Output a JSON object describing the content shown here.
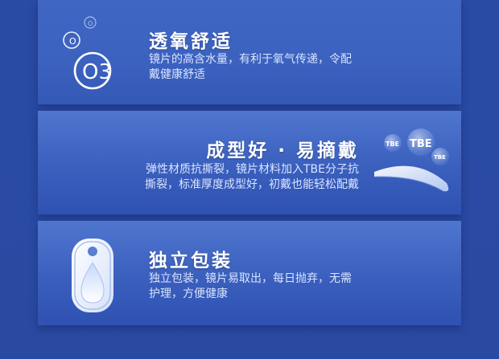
{
  "features": [
    {
      "title": "透氧舒适",
      "desc_lines": [
        "镜片的高含水量，有利于氧气传递，令配",
        "戴健康舒适"
      ],
      "icon": "o3-bubbles-icon",
      "icon_text": {
        "big": "O3",
        "small1": "O",
        "small2": "O"
      }
    },
    {
      "title": "成型好 · 易摘戴",
      "desc_lines": [
        "弹性材质抗撕裂，镜片材料加入TBE分子抗",
        "撕裂，标准厚度成型好，初戴也能轻松配戴"
      ],
      "icon": "lens-tbe-icon",
      "icon_text": {
        "tbe_large": "TBE",
        "tbe_small1": "TBE",
        "tbe_small2": "TBE"
      }
    },
    {
      "title": "独立包装",
      "desc_lines": [
        "独立包装，镜片易取出，每日抛弃，无需",
        "护理，方便健康"
      ],
      "icon": "blister-pack-icon"
    }
  ],
  "colors": {
    "background": "#2a4ba4",
    "card": "#3f66c3",
    "title": "#ffffff",
    "desc": "#d9e4ff"
  }
}
